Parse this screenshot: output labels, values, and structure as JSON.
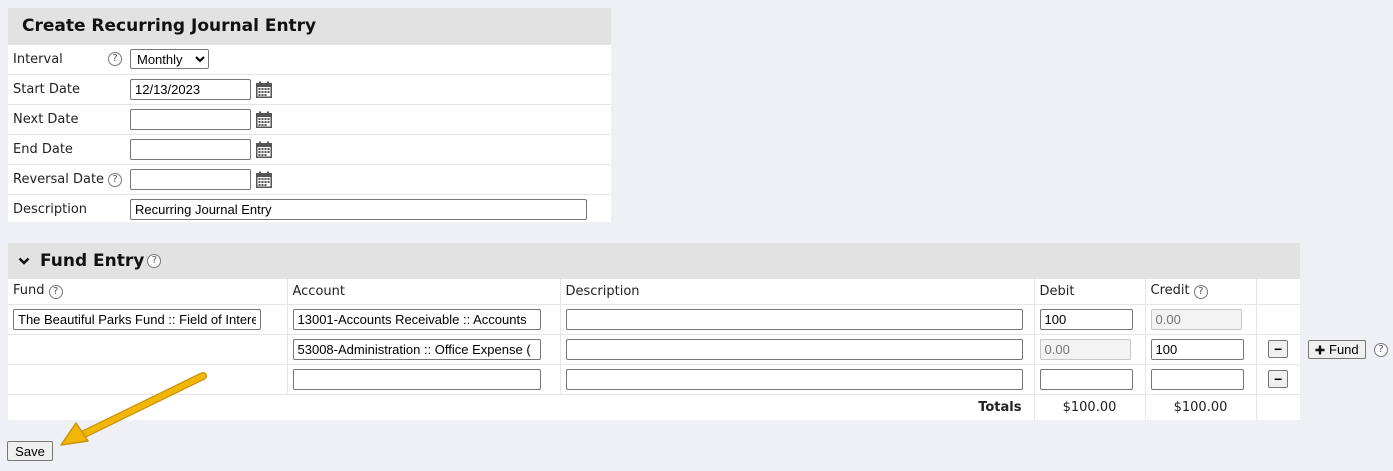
{
  "form": {
    "title": "Create Recurring Journal Entry",
    "interval": {
      "label": "Interval",
      "value": "Monthly",
      "options": [
        "Monthly"
      ]
    },
    "start_date": {
      "label": "Start Date",
      "value": "12/13/2023"
    },
    "next_date": {
      "label": "Next Date",
      "value": ""
    },
    "end_date": {
      "label": "End Date",
      "value": ""
    },
    "reversal_date": {
      "label": "Reversal Date",
      "value": ""
    },
    "description": {
      "label": "Description",
      "value": "Recurring Journal Entry"
    }
  },
  "fund_entry": {
    "title": "Fund Entry",
    "columns": {
      "fund": "Fund",
      "account": "Account",
      "description": "Description",
      "debit": "Debit",
      "credit": "Credit"
    },
    "rows": [
      {
        "fund": "The Beautiful Parks Fund :: Field of Interest",
        "account": "13001-Accounts Receivable :: Accounts",
        "description": "",
        "debit": "100",
        "credit": "",
        "credit_placeholder": "0.00",
        "debit_placeholder": ""
      },
      {
        "fund": "",
        "account": "53008-Administration :: Office Expense (",
        "description": "",
        "debit": "",
        "debit_placeholder": "0.00",
        "credit": "100",
        "credit_placeholder": ""
      },
      {
        "fund": "",
        "account": "",
        "description": "",
        "debit": "",
        "credit": "",
        "debit_placeholder": "",
        "credit_placeholder": ""
      }
    ],
    "totals": {
      "label": "Totals",
      "debit": "$100.00",
      "credit": "$100.00"
    },
    "add_fund_label": "Fund"
  },
  "save_label": "Save",
  "colors": {
    "panel_header": "#e2e2e2",
    "background": "#eef0f5",
    "arrow": "#f2b705"
  }
}
